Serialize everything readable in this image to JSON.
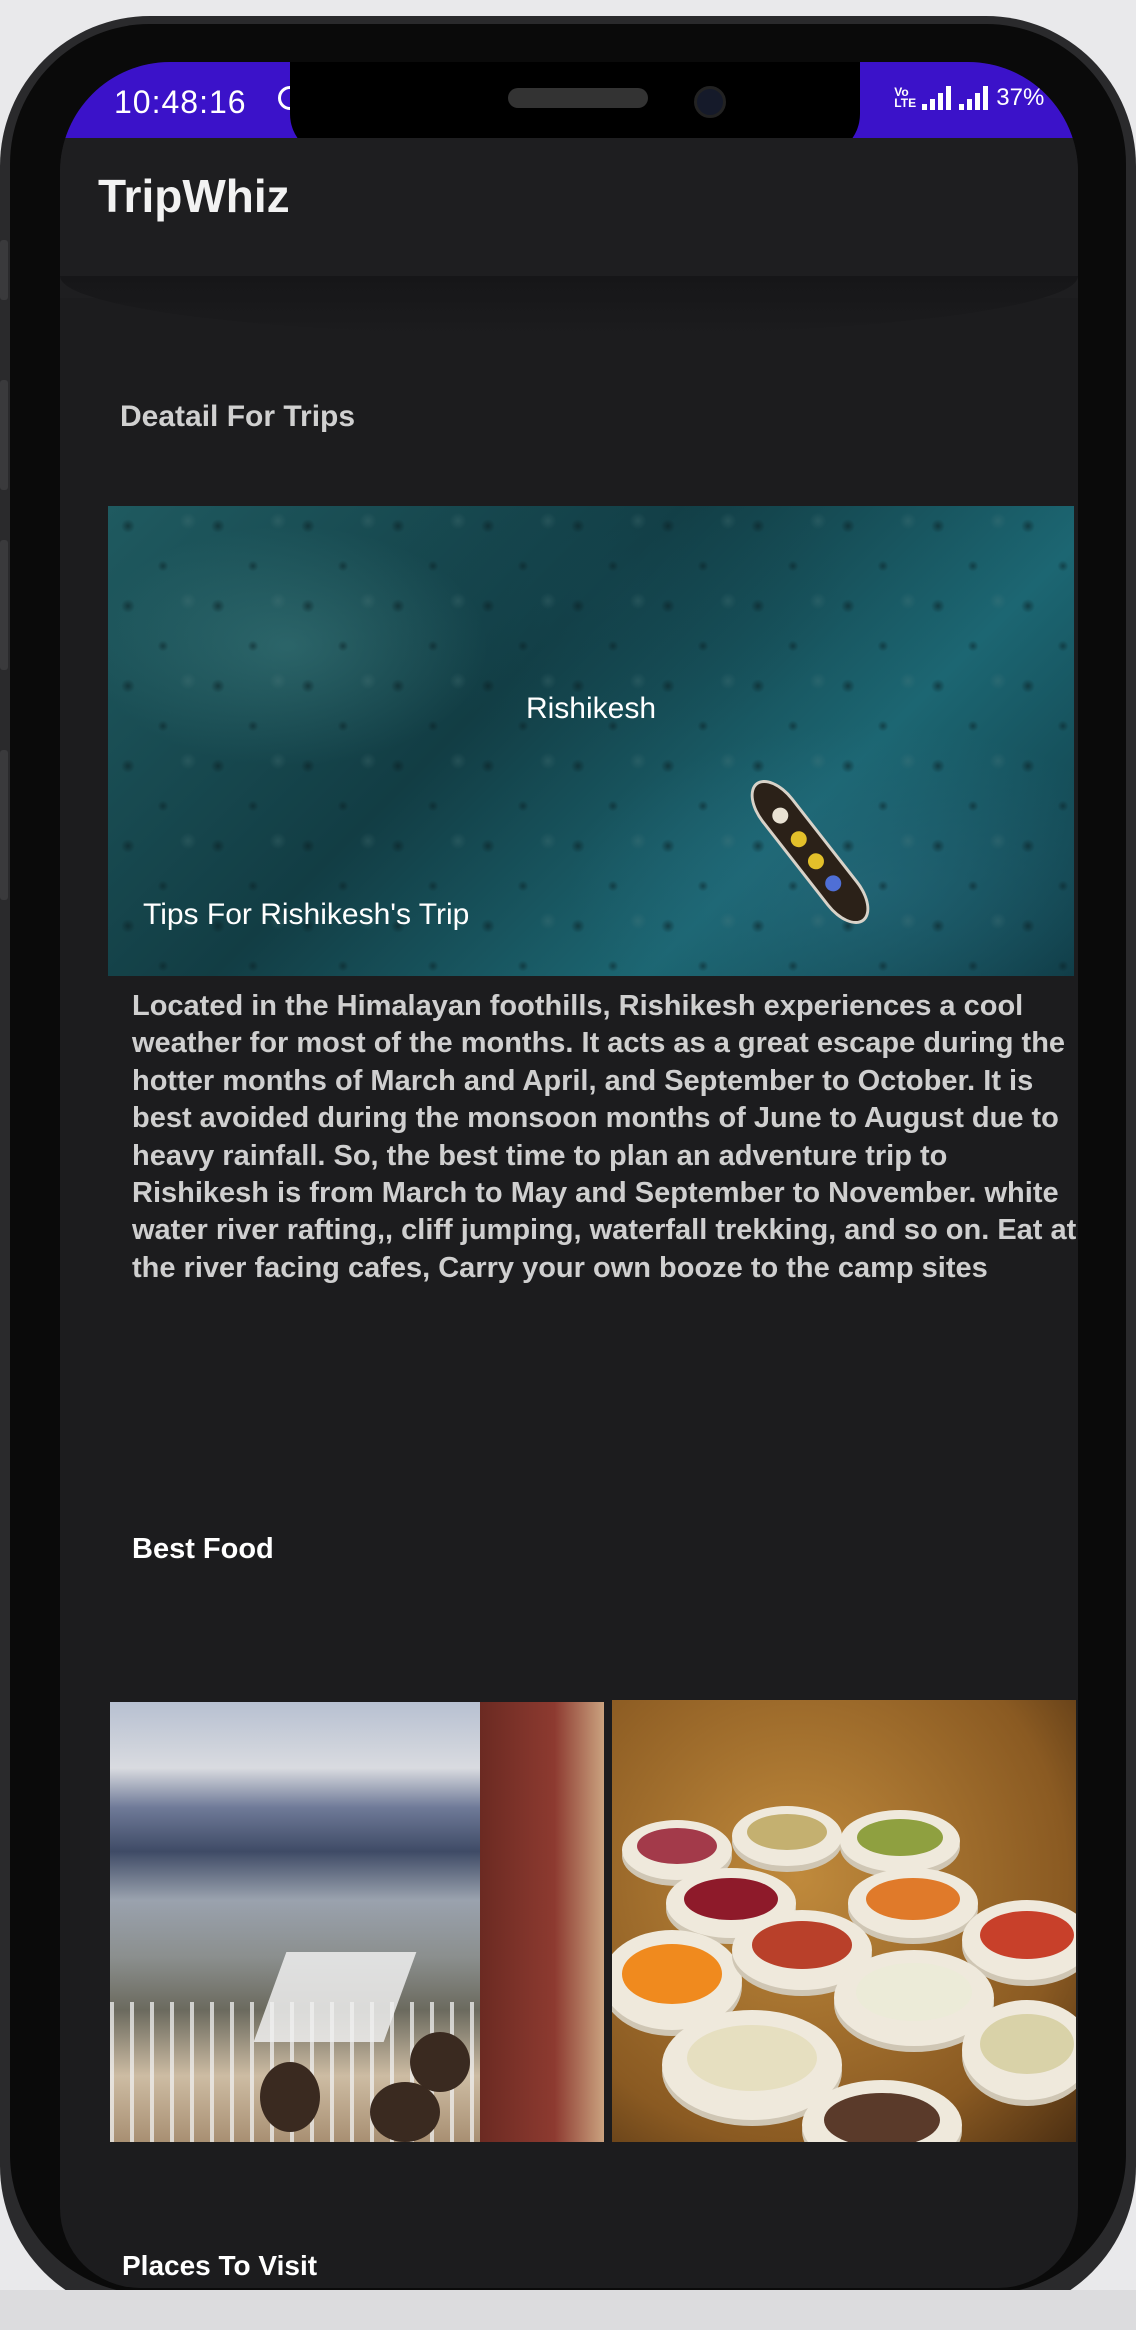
{
  "status_bar": {
    "time": "10:48:16",
    "network_label": "Vo LTE",
    "battery": "37%"
  },
  "app_bar": {
    "title": "TripWhiz"
  },
  "detail": {
    "section_title": "Deatail For Trips",
    "hero_place": "Rishikesh",
    "hero_tips": "Tips For Rishikesh's Trip",
    "description": "Located in the Himalayan foothills, Rishikesh experiences a cool weather for most of the months. It acts as a great escape during the hotter months of March and April, and September to October. It is best avoided during the monsoon months of June to August due to heavy rainfall. So, the best time to plan an adventure trip to Rishikesh is from March to May and September to November. white water river rafting,, cliff jumping, waterfall trekking, and so on. Eat at the river facing cafes, Carry your own booze to the camp sites"
  },
  "food": {
    "title": "Best Food"
  },
  "places": {
    "title": "Places To Visit"
  },
  "colors": {
    "status_bar": "#3b12c9",
    "background": "#1c1c1e",
    "text": "#cfcfcf"
  }
}
